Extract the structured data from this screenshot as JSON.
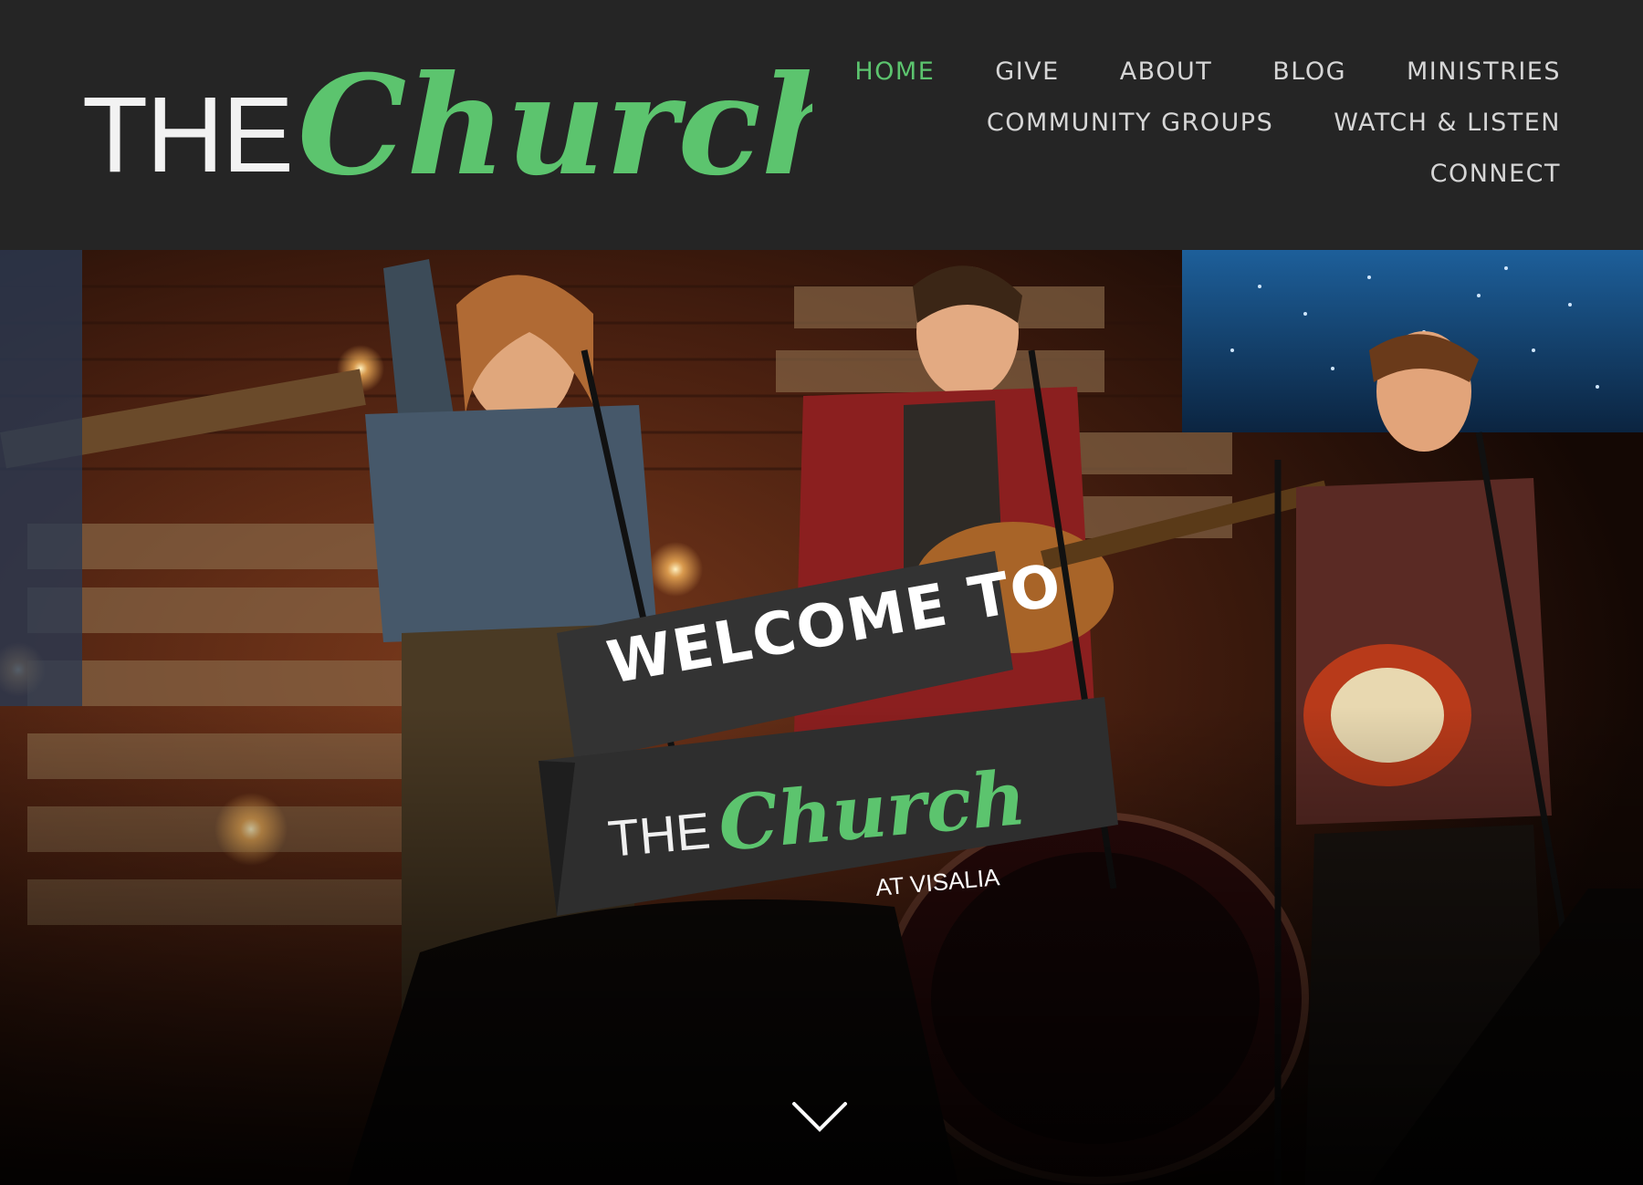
{
  "site": {
    "logo": {
      "word_the": "THE",
      "word_church": "Church"
    },
    "nav": [
      {
        "label": "HOME",
        "active": true
      },
      {
        "label": "GIVE",
        "active": false
      },
      {
        "label": "ABOUT",
        "active": false
      },
      {
        "label": "BLOG",
        "active": false
      },
      {
        "label": "MINISTRIES",
        "active": false
      },
      {
        "label": "COMMUNITY GROUPS",
        "active": false
      },
      {
        "label": "WATCH & LISTEN",
        "active": false
      },
      {
        "label": "CONNECT",
        "active": false
      }
    ]
  },
  "hero": {
    "welcome_text": "WELCOME TO",
    "banner_the": "THE",
    "banner_church": "Church",
    "banner_location": "AT VISALIA",
    "scroll_icon": "chevron-down-icon"
  },
  "colors": {
    "header_bg": "#252525",
    "accent_green": "#5cc46e",
    "nav_text": "#d6d6d6",
    "banner_bg": "#2e2e2e"
  }
}
